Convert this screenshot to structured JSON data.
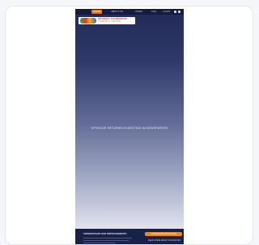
{
  "nav": {
    "items": [
      {
        "label": "HOME",
        "active": true
      },
      {
        "label": "ABOUT US",
        "active": false
      },
      {
        "label": "WORK",
        "active": false
      },
      {
        "label": "FAQ",
        "active": false
      },
      {
        "label": "LOGIN",
        "active": false
      }
    ],
    "icons": [
      "search-icon",
      "menu-icon"
    ]
  },
  "logo": {
    "title": "NATIONAL FOUNDATION",
    "subtitle": "COMMUNITY SUPPORT"
  },
  "hero": {
    "text": "SPONSOR RETURNS IN MEETING IN NEWSPAPERS"
  },
  "footer": {
    "heading": "UNDERSTAND OUR IMPROVEMENTS",
    "cta_label": "CONTRIBUTE INITIATIVES",
    "link_label": "READ MORE ABOUT FOUNDATION"
  },
  "colors": {
    "accent": "#e4731c",
    "nav_bg": "#141b3f",
    "footer_bg": "#1a2149"
  }
}
